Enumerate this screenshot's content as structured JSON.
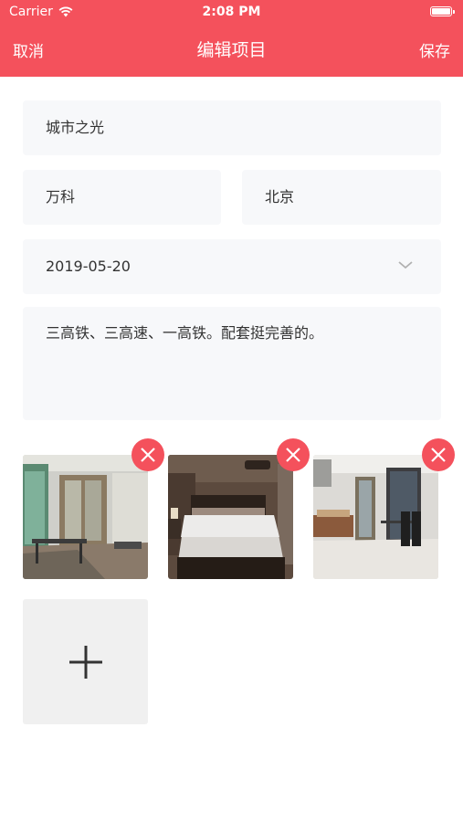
{
  "status_bar": {
    "carrier": "Carrier",
    "time": "2:08 PM"
  },
  "nav": {
    "cancel": "取消",
    "title": "编辑项目",
    "save": "保存"
  },
  "form": {
    "project_name": "城市之光",
    "developer": "万科",
    "city": "北京",
    "date": "2019-05-20",
    "description": "三高铁、三高速、一高铁。配套挺完善的。"
  },
  "photos": [
    {
      "icon": "delete-icon"
    },
    {
      "icon": "delete-icon"
    },
    {
      "icon": "delete-icon"
    }
  ],
  "add_photo": {
    "icon": "plus-icon"
  },
  "colors": {
    "accent": "#f4515c",
    "field_bg": "#f7f8fa",
    "add_tile_bg": "#f0f0f0"
  }
}
